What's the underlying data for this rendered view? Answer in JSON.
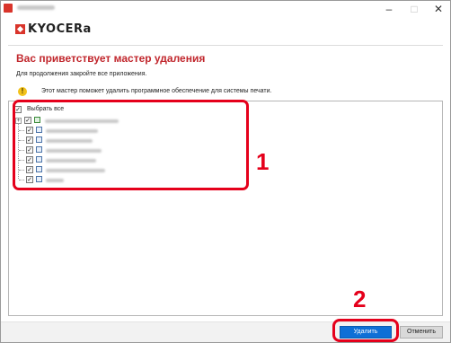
{
  "window": {
    "minimize": "–",
    "maximize": "□",
    "close": "✕"
  },
  "brand": {
    "name": "KYOCERa"
  },
  "header": {
    "title": "Вас приветствует мастер удаления",
    "instruction": "Для продолжения закройте все приложения.",
    "info": "Этот мастер поможет удалить программное обеспечение для системы печати."
  },
  "tree": {
    "select_all": "Выбрать все",
    "select_all_checked": true
  },
  "callouts": {
    "one": "1",
    "two": "2"
  },
  "footer": {
    "remove_button": "Удалить",
    "cancel_button": "Отменить"
  },
  "colors": {
    "accent_red": "#c1272d",
    "highlight_red": "#e5001b",
    "primary_button": "#0e6fd6",
    "info_icon": "#f2c21b"
  }
}
